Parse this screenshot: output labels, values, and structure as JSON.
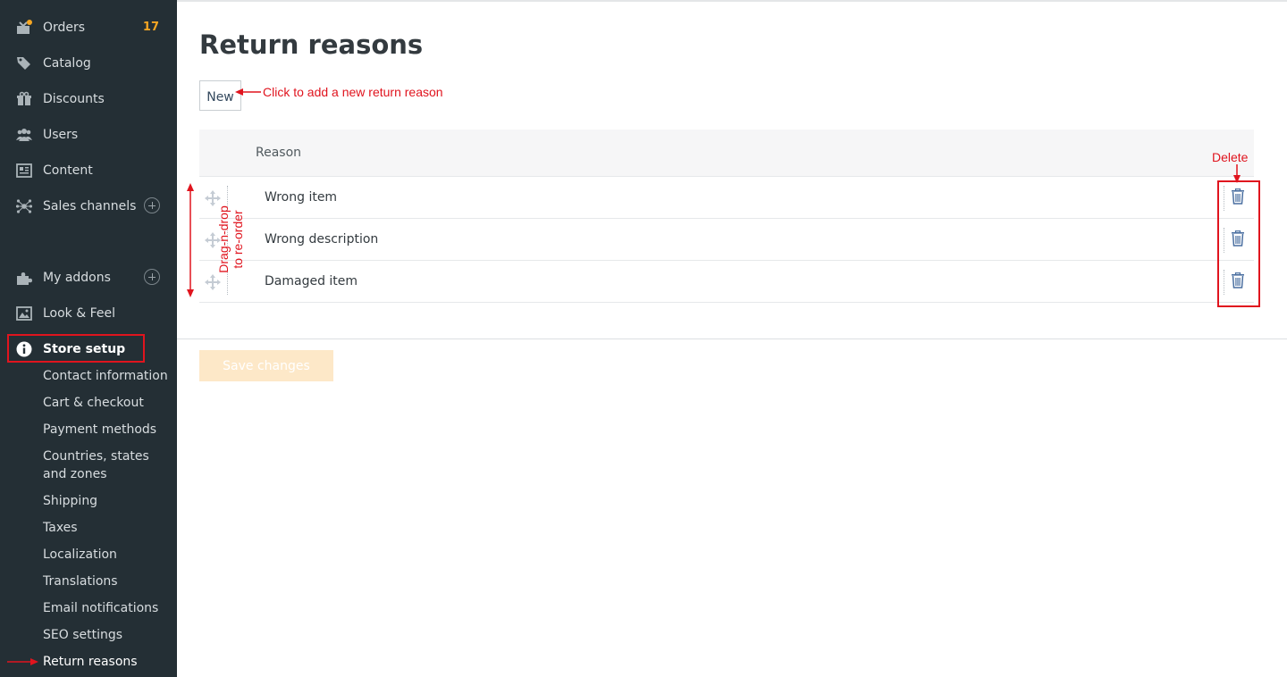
{
  "sidebar": {
    "items": [
      {
        "label": "Orders",
        "icon": "orders-icon",
        "badge": "17"
      },
      {
        "label": "Catalog",
        "icon": "tag-icon"
      },
      {
        "label": "Discounts",
        "icon": "gift-icon"
      },
      {
        "label": "Users",
        "icon": "users-icon"
      },
      {
        "label": "Content",
        "icon": "content-icon"
      },
      {
        "label": "Sales channels",
        "icon": "network-icon"
      },
      {
        "label": "My addons",
        "icon": "puzzle-icon"
      },
      {
        "label": "Look & Feel",
        "icon": "image-icon"
      },
      {
        "label": "Store setup",
        "icon": "info-icon"
      }
    ],
    "submenu": [
      "Contact information",
      "Cart & checkout",
      "Payment methods",
      "Countries, states and zones",
      "Shipping",
      "Taxes",
      "Localization",
      "Translations",
      "Email notifications",
      "SEO settings",
      "Return reasons"
    ]
  },
  "main": {
    "title": "Return reasons",
    "new_label": "New",
    "column_header": "Reason",
    "rows": [
      "Wrong item",
      "Wrong description",
      "Damaged item"
    ],
    "save_label": "Save changes"
  },
  "annotations": {
    "new_hint": "Click to add a new return reason",
    "drag_hint_line1": "Drag-n-drop",
    "drag_hint_line2": "to re-order",
    "delete_hint": "Delete"
  },
  "colors": {
    "sidebar_bg": "#242f35",
    "badge": "#f5a623",
    "annotation": "#e0141e",
    "save_button_bg": "#fde8c8",
    "icon_blue": "#34495e"
  }
}
